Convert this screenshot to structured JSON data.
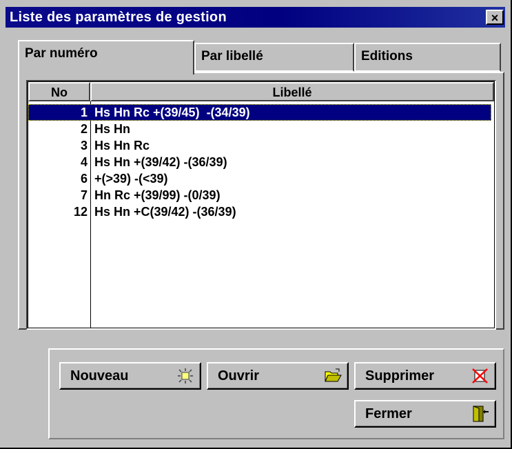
{
  "window": {
    "title": "Liste des paramètres de gestion",
    "close_glyph": "×"
  },
  "tabs": [
    {
      "label": "Par numéro",
      "active": true
    },
    {
      "label": "Par libellé",
      "active": false
    },
    {
      "label": "Editions",
      "active": false
    }
  ],
  "list": {
    "columns": [
      "No",
      "Libellé"
    ],
    "rows": [
      {
        "no": "1",
        "libelle": "Hs Hn Rc +(39/45)  -(34/39)",
        "selected": true
      },
      {
        "no": "2",
        "libelle": "Hs Hn"
      },
      {
        "no": "3",
        "libelle": "Hs Hn Rc"
      },
      {
        "no": "4",
        "libelle": "Hs Hn +(39/42) -(36/39)"
      },
      {
        "no": "6",
        "libelle": "+(>39) -(<39)"
      },
      {
        "no": "7",
        "libelle": "Hn Rc +(39/99) -(0/39)"
      },
      {
        "no": "12",
        "libelle": "Hs Hn +C(39/42) -(36/39)"
      }
    ]
  },
  "buttons": {
    "new": {
      "label": "Nouveau",
      "icon": "sun-icon"
    },
    "open": {
      "label": "Ouvrir",
      "icon": "open-folder-icon"
    },
    "delete": {
      "label": "Supprimer",
      "icon": "delete-x-icon"
    },
    "close": {
      "label": "Fermer",
      "icon": "exit-door-icon"
    }
  },
  "colors": {
    "selection": "#000080",
    "titlebar": "#000080",
    "face": "#c0c0c0"
  }
}
